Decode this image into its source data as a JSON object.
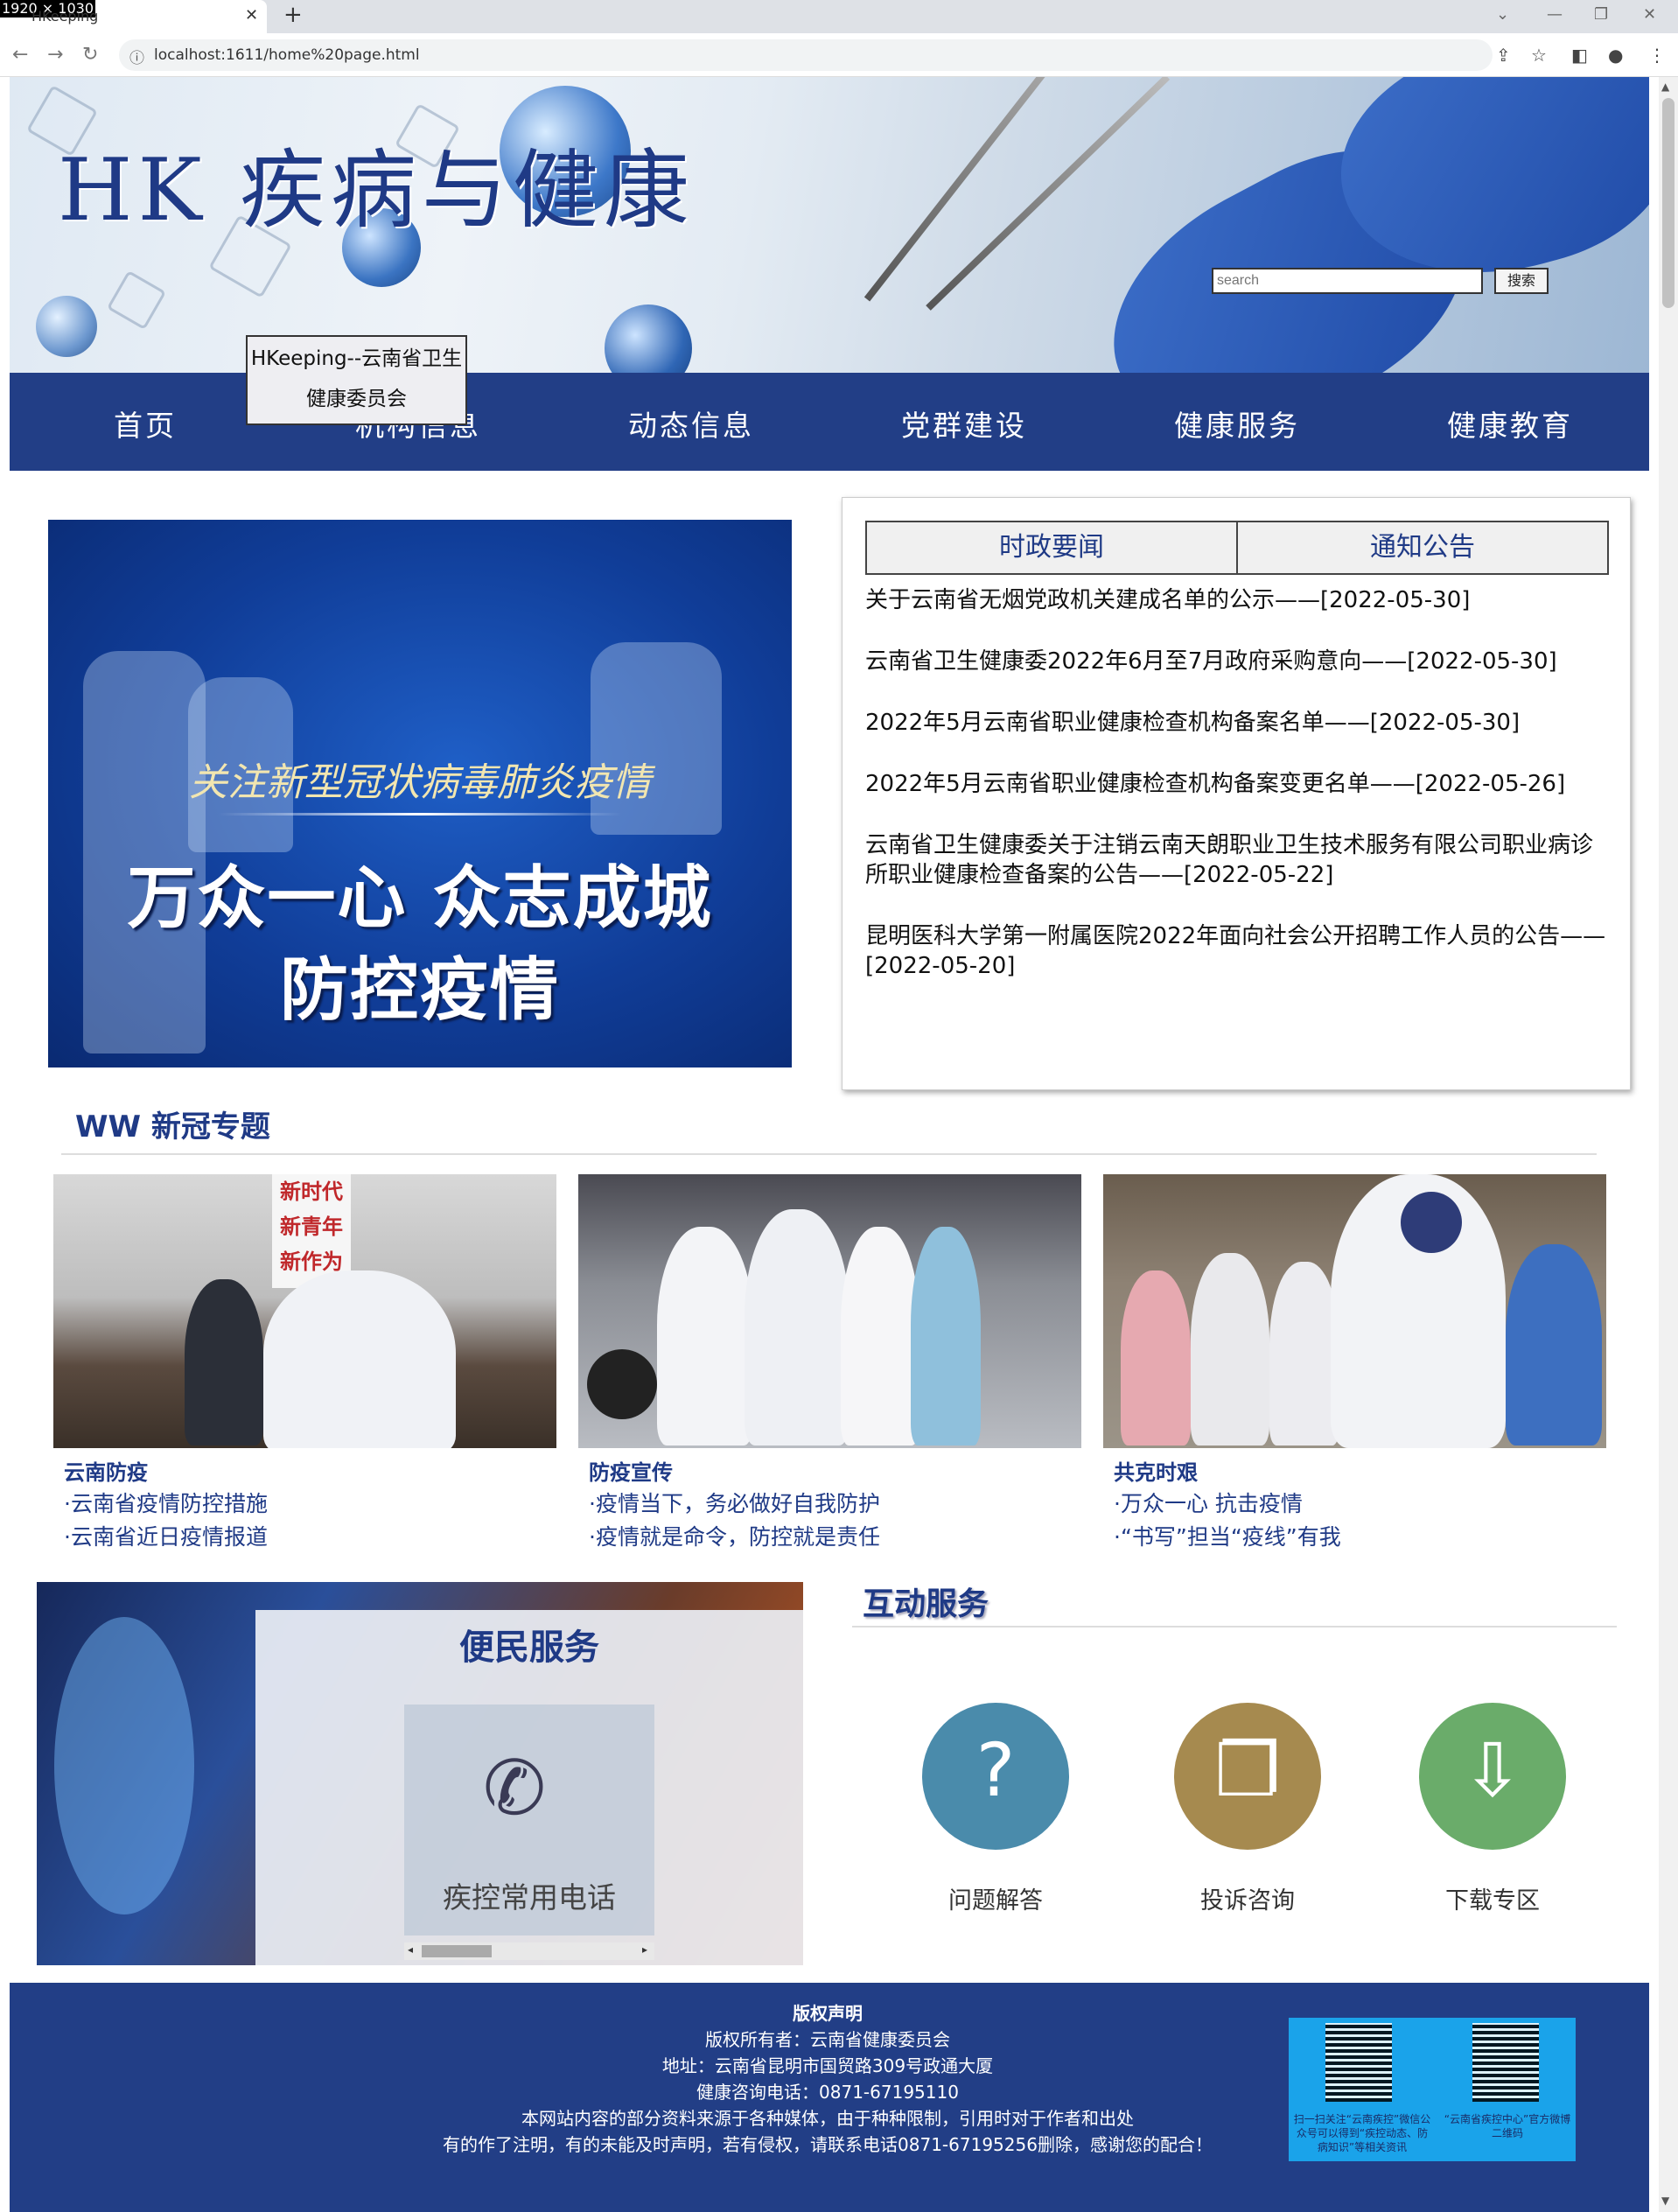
{
  "browser": {
    "dims_label": "1920 × 1030",
    "tab_title": "HKeeping",
    "url": "localhost:1611/home%20page.html"
  },
  "header": {
    "logo": "HK 疾病与健康",
    "search_placeholder": "search",
    "search_button": "搜索"
  },
  "nav": {
    "items": [
      "首页",
      "机构信息",
      "动态信息",
      "党群建设",
      "健康服务",
      "健康教育"
    ]
  },
  "tooltip": {
    "line1": "HKeeping--云南省卫生",
    "line2": "健康委员会"
  },
  "hero": {
    "line1": "关注新型冠状病毒肺炎疫情",
    "line2": "万众一心 众志成城",
    "line3": "防控疫情"
  },
  "news": {
    "tabs": [
      "时政要闻",
      "通知公告"
    ],
    "items": [
      "关于云南省无烟党政机关建成名单的公示——[2022-05-30]",
      "云南省卫生健康委2022年6月至7月政府采购意向——[2022-05-30]",
      "2022年5月云南省职业健康检查机构备案名单——[2022-05-30]",
      "2022年5月云南省职业健康检查机构备案变更名单——[2022-05-26]",
      "云南省卫生健康委关于注销云南天朗职业卫生技术服务有限公司职业病诊所职业健康检查备案的公告——[2022-05-22]",
      "昆明医科大学第一附属医院2022年面向社会公开招聘工作人员的公告——[2022-05-20]"
    ]
  },
  "covid": {
    "title": "WW 新冠专题",
    "card1_overlay": "新时代\n新青年\n新作为",
    "cards": [
      {
        "caption": "云南防疫",
        "l1": "·云南省疫情防控措施",
        "l2": "·云南省近日疫情报道"
      },
      {
        "caption": "防疫宣传",
        "l1": "·疫情当下，务必做好自我防护",
        "l2": "·疫情就是命令，防控就是责任"
      },
      {
        "caption": "共克时艰",
        "l1": "·万众一心 抗击疫情",
        "l2": "·“书写”担当“疫线”有我"
      }
    ]
  },
  "service": {
    "title": "便民服务",
    "item": "疾控常用电话"
  },
  "interactive": {
    "title": "互动服务",
    "items": [
      "问题解答",
      "投诉咨询",
      "下载专区"
    ],
    "colors": [
      "#4a8bab",
      "#a68a4f",
      "#6aac6a"
    ]
  },
  "footer": {
    "title": "版权声明",
    "owner": "版权所有者：云南省健康委员会",
    "address": "地址：云南省昆明市国贸路309号政通大厦",
    "phone": "健康咨询电话：0871-67195110",
    "notice1": "本网站内容的部分资料来源于各种媒体，由于种种限制，引用时对于作者和出处",
    "notice2": "有的作了注明，有的未能及时声明，若有侵权，请联系电话0871-67195256删除，感谢您的配合！",
    "qr1_text": "扫一扫关注“云南疾控”微信公众号可以得到“疾控动态、防病知识”等相关资讯",
    "qr2_text": "“云南省疾控中心”官方微博二维码"
  }
}
